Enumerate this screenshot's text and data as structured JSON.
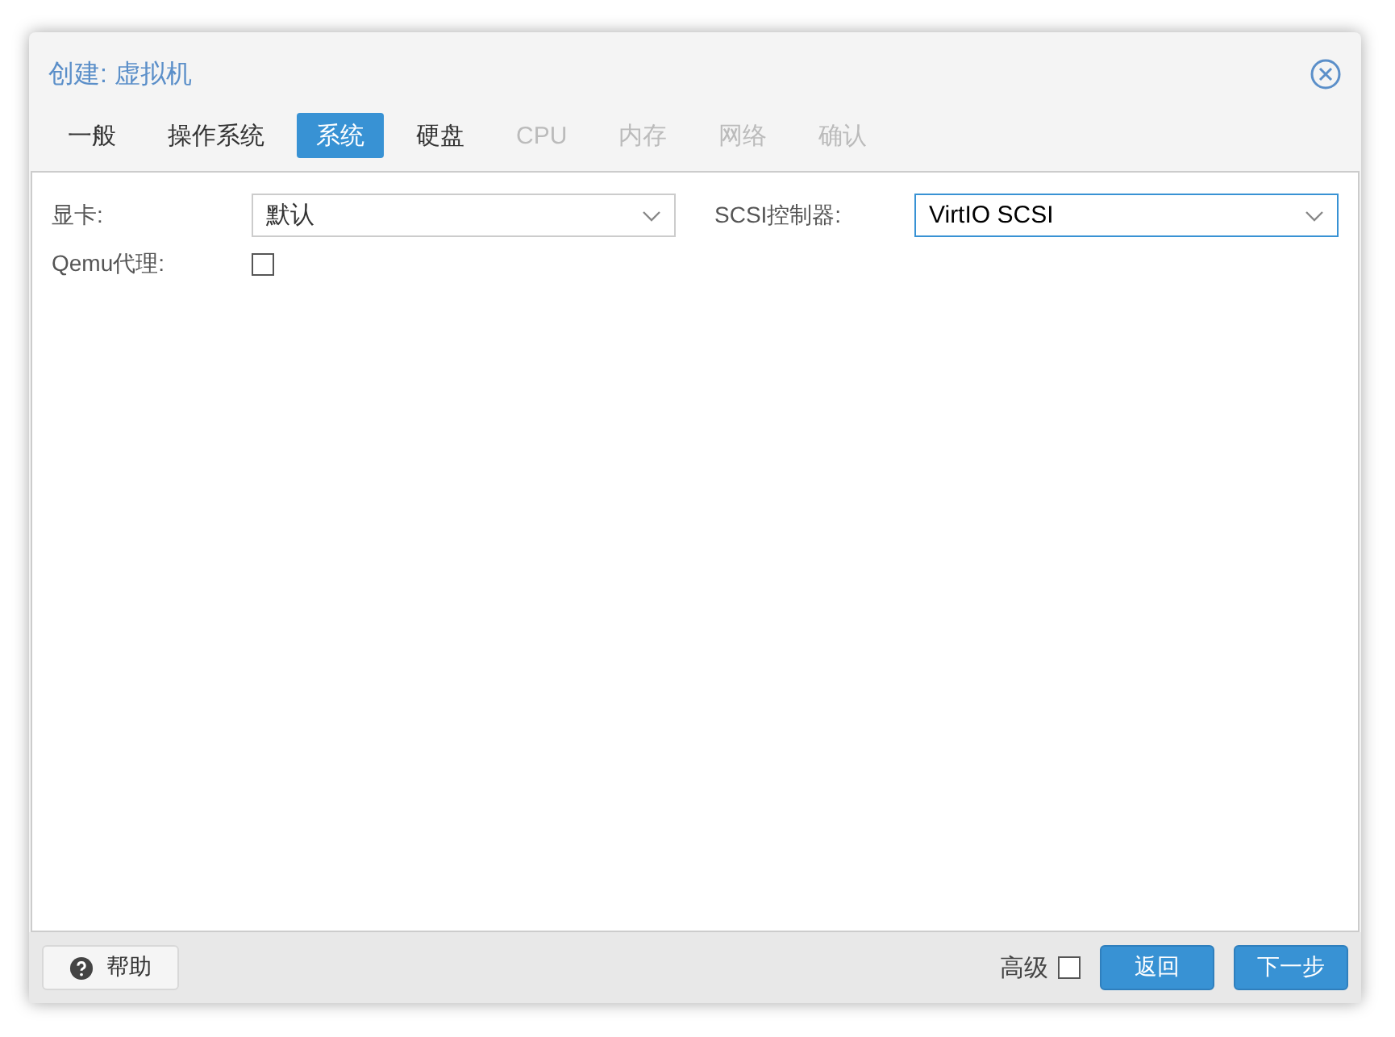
{
  "window": {
    "title": "创建: 虚拟机"
  },
  "tabs": [
    {
      "label": "一般",
      "selected": false,
      "disabled": false
    },
    {
      "label": "操作系统",
      "selected": false,
      "disabled": false
    },
    {
      "label": "系统",
      "selected": true,
      "disabled": false
    },
    {
      "label": "硬盘",
      "selected": false,
      "disabled": false
    },
    {
      "label": "CPU",
      "selected": false,
      "disabled": true
    },
    {
      "label": "内存",
      "selected": false,
      "disabled": true
    },
    {
      "label": "网络",
      "selected": false,
      "disabled": true
    },
    {
      "label": "确认",
      "selected": false,
      "disabled": true
    }
  ],
  "fields": [
    {
      "kind": "select",
      "label": "显卡:",
      "value": "默认",
      "focused": false
    },
    {
      "kind": "select",
      "label": "SCSI控制器:",
      "value": "VirtIO SCSI",
      "focused": true
    },
    {
      "kind": "checkbox",
      "label": "Qemu代理:",
      "checked": false
    }
  ],
  "footer": {
    "help": "帮助",
    "advanced": {
      "label": "高级",
      "checked": false
    },
    "buttons": [
      "返回",
      "下一步"
    ]
  }
}
